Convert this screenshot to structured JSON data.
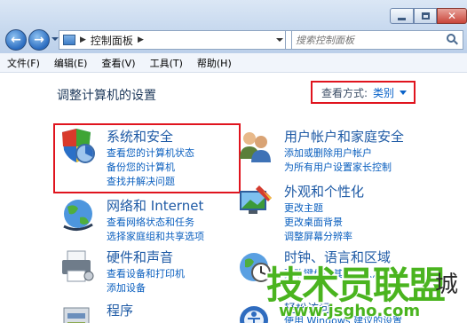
{
  "address": {
    "crumb": "控制面板",
    "search_placeholder": "搜索控制面板"
  },
  "menu": [
    "文件(F)",
    "编辑(E)",
    "查看(V)",
    "工具(T)",
    "帮助(H)"
  ],
  "content": {
    "title": "调整计算机的设置",
    "view_by_label": "查看方式:",
    "view_by_value": "类别"
  },
  "categories": {
    "system": {
      "name": "系统和安全",
      "links": [
        "查看您的计算机状态",
        "备份您的计算机",
        "查找并解决问题"
      ]
    },
    "user": {
      "name": "用户帐户和家庭安全",
      "links": [
        "添加或删除用户帐户",
        "为所有用户设置家长控制"
      ]
    },
    "network": {
      "name": "网络和 Internet",
      "links": [
        "查看网络状态和任务",
        "选择家庭组和共享选项"
      ]
    },
    "appearance": {
      "name": "外观和个性化",
      "links": [
        "更改主题",
        "更改桌面背景",
        "调整屏幕分辨率"
      ]
    },
    "hardware": {
      "name": "硬件和声音",
      "links": [
        "查看设备和打印机",
        "添加设备"
      ]
    },
    "clock": {
      "name": "时钟、语言和区域",
      "links": [
        "更改键盘或其他输入法"
      ]
    },
    "programs": {
      "name": "程序"
    },
    "ease": {
      "name": "轻松访问",
      "links": [
        "使用 Windows 建议的设置"
      ]
    }
  },
  "watermark": {
    "main": "技术员联盟",
    "url": "www.jsgho.com",
    "side": "城"
  }
}
